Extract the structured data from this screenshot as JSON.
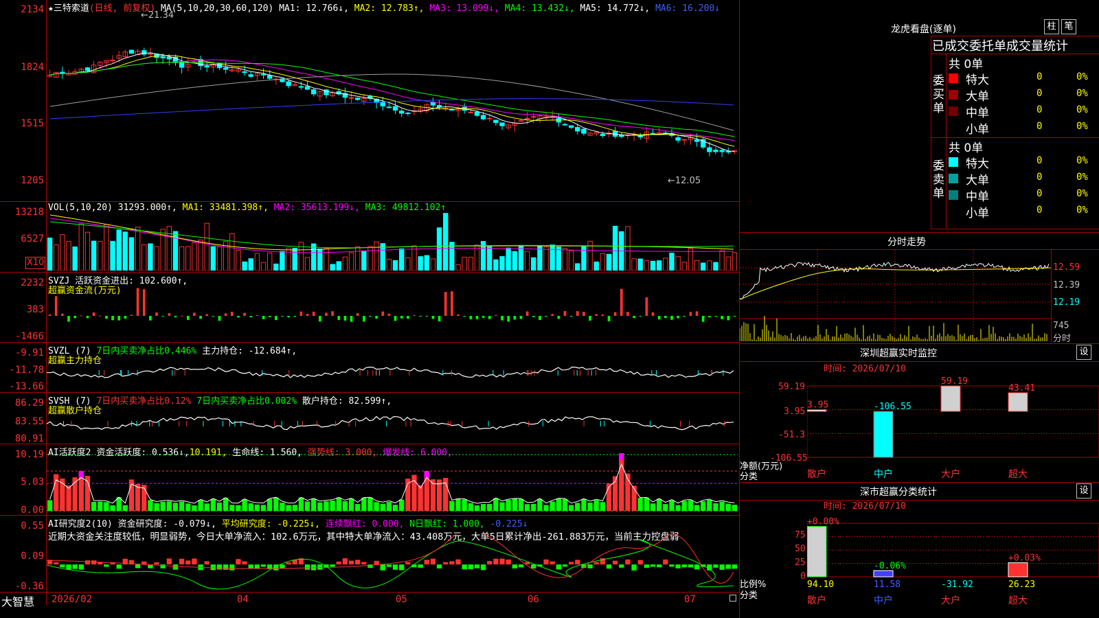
{
  "main_chart": {
    "star": "★",
    "stock_name": "三特索道",
    "period": "(日线, 前复权)",
    "ma_label": "MA(5,10,20,30,60,120)",
    "ma1": "MA1: 12.766↓,",
    "ma2": "MA2: 12.783↑,",
    "ma3": "MA3: 13.099↓,",
    "ma4": "MA4: 13.432↓,",
    "ma5": "MA5: 14.772↓,",
    "ma6": "MA6: 16.200↓",
    "high_marker": "←21.34",
    "low_marker": "←12.05",
    "y_ticks": [
      "2134",
      "1824",
      "1515",
      "1205"
    ]
  },
  "volume": {
    "label": "VOL(5,10,20)",
    "value": "31293.000↑,",
    "ma1": "MA1: 33481.398↑,",
    "ma2": "MA2: 35613.199↓,",
    "ma3": "MA3: 49812.102↑",
    "y_ticks": [
      "13218",
      "6527"
    ],
    "multiplier": "X10"
  },
  "svzj": {
    "label": "SVZJ",
    "value": "活跃资金进出: 102.600↑,",
    "sub": "超赢资金流(万元)",
    "y_ticks": [
      "2232",
      "383",
      "-1466"
    ]
  },
  "svzl": {
    "label": "SVZL (7)",
    "v1": "7日内买卖净占比0.446%",
    "v2": "主力持仓: -12.684↑,",
    "sub": "超赢主力持仓",
    "y_ticks": [
      "-9.91",
      "-11.78",
      "-13.66"
    ]
  },
  "svsh": {
    "label": "SVSH (7)",
    "v1": "7日内买卖净占比0.12%",
    "v2": "7日内买卖净占比0.002%",
    "v3": "散户持仓: 82.599↑,",
    "sub": "超赢散户持仓",
    "y_ticks": [
      "86.29",
      "83.55",
      "80.91"
    ]
  },
  "ai_active": {
    "label": "AI活跃度2",
    "v1": "资金活跃度: 0.536↓,",
    "v2": "10.191,",
    "v3": "生命线: 1.560,",
    "v4": "强势线: 3.000,",
    "v5": "爆发线: 6.000,",
    "y_ticks": [
      "10.19",
      "5.03",
      "0.00"
    ]
  },
  "ai_research": {
    "label": "AI研究度2(10)",
    "v1": "资金研究度: -0.079↓,",
    "v2": "平均研究度: -0.225↓,",
    "v3": "连续飘红: 0.000,",
    "v4": "N日飘红: 1.000,",
    "v5": "-0.225↓",
    "comment": "近期大资金关注度较低，明显弱势，今日大单净流入：102.6万元，其中特大单净流入：43.408万元，大单5日累计净出-261.883万元，当前主力控盘弱",
    "y_ticks": [
      "0.55",
      "0.09",
      "-0.36"
    ]
  },
  "x_axis": {
    "brand": "大智慧",
    "labels": [
      "2026/02",
      "04",
      "05",
      "06",
      "07"
    ]
  },
  "dragon_tiger": {
    "title": "龙虎看盘(逐单)",
    "btn_bar": "柱",
    "btn_detail": "笔",
    "header": "已成交委托单成交量统计",
    "buy_label": "委买单",
    "sell_label": "委卖单",
    "buy_total": "共 0单",
    "sell_total": "共 0单",
    "buy_rows": [
      {
        "name": "特大",
        "count": "0",
        "pct": "0%",
        "color": "#ff0000"
      },
      {
        "name": "大单",
        "count": "0",
        "pct": "0%",
        "color": "#a00000"
      },
      {
        "name": "中单",
        "count": "0",
        "pct": "0%",
        "color": "#700000"
      },
      {
        "name": "小单",
        "count": "0",
        "pct": "0%",
        "color": "#000000"
      }
    ],
    "sell_rows": [
      {
        "name": "特大",
        "count": "0",
        "pct": "0%",
        "color": "#00ffff"
      },
      {
        "name": "大单",
        "count": "0",
        "pct": "0%",
        "color": "#00a0a0"
      },
      {
        "name": "中单",
        "count": "0",
        "pct": "0%",
        "color": "#008080"
      },
      {
        "name": "小单",
        "count": "0",
        "pct": "0%",
        "color": "#000000"
      }
    ]
  },
  "intraday": {
    "title": "分时走势",
    "prices": [
      "12.59",
      "12.39",
      "12.19"
    ],
    "vol_tick": "745",
    "vol_label": "分时"
  },
  "sz_monitor": {
    "title": "深圳超赢实时监控",
    "btn": "设",
    "time": "时间: 2026/07/10",
    "y_ticks": [
      "59.19",
      "3.95",
      "-51.3",
      "-106.55"
    ],
    "axis_title": "净额(万元)",
    "axis_sub": "分类",
    "categories": [
      "散户",
      "中户",
      "大户",
      "超大"
    ],
    "values": [
      3.95,
      -106.55,
      59.19,
      43.41
    ],
    "value_labels": [
      "3.95",
      "-106.55",
      "59.19",
      "43.41"
    ]
  },
  "sz_stats": {
    "title": "深市超赢分类统计",
    "btn": "设",
    "time": "时间: 2026/07/10",
    "y_ticks": [
      "75",
      "50",
      "25",
      "0"
    ],
    "axis_title": "比例%",
    "axis_sub": "分类",
    "categories": [
      "散户",
      "中户",
      "大户",
      "超大"
    ],
    "bottom_values": [
      "94.10",
      "11.58",
      "-31.92",
      "26.23"
    ],
    "top_labels": [
      "+0.00%",
      "-0.06%",
      "",
      "+0.03%"
    ],
    "bar_heights_pct": [
      94.1,
      11.58,
      0,
      26.23
    ]
  },
  "chart_data": [
    {
      "type": "bar",
      "title": "深圳超赢实时监控",
      "ylabel": "净额(万元)",
      "categories": [
        "散户",
        "中户",
        "大户",
        "超大"
      ],
      "values": [
        3.95,
        -106.55,
        59.19,
        43.41
      ],
      "ylim": [
        -106.55,
        59.19
      ]
    },
    {
      "type": "bar",
      "title": "深市超赢分类统计",
      "ylabel": "比例%",
      "categories": [
        "散户",
        "中户",
        "大户",
        "超大"
      ],
      "values": [
        94.1,
        11.58,
        -31.92,
        26.23
      ],
      "ylim": [
        0,
        100
      ]
    }
  ]
}
